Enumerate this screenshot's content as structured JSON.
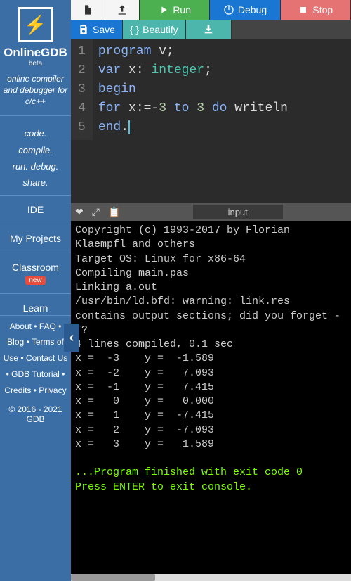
{
  "brand": {
    "logo_symbol": "⚡",
    "name": "OnlineGDB",
    "beta": "beta",
    "tagline": "online compiler and debugger for c/c++",
    "slogan_lines": [
      "code.",
      "compile.",
      "run. debug.",
      "share."
    ]
  },
  "nav": {
    "ide": "IDE",
    "projects": "My Projects",
    "classroom": "Classroom",
    "new_badge": "new",
    "learn": "Learn"
  },
  "footer": {
    "links": "About • FAQ • Blog • Terms of Use • Contact Us • GDB Tutorial • Credits • Privacy",
    "copyright": "© 2016 - 2021 GDB"
  },
  "toolbar": {
    "run": "Run",
    "debug": "Debug",
    "stop": "Stop",
    "save": "Save",
    "beautify": "Beautify"
  },
  "editor": {
    "lines": [
      "1",
      "2",
      "3",
      "4",
      "5"
    ],
    "code": {
      "l1": {
        "kw": "program",
        "v": " v;"
      },
      "l2": {
        "kw": "var",
        "v": " x: ",
        "type": "integer",
        "end": ";"
      },
      "l3": {
        "kw": "begin"
      },
      "l4": {
        "kw1": "for",
        "x": " x",
        "op": ":=-",
        "n1": "3 ",
        "kw2": "to ",
        "n2": "3 ",
        "kw3": "do ",
        "fn": "writeln"
      },
      "l5": {
        "kw": "end",
        "dot": "."
      }
    }
  },
  "terminal": {
    "input_tab": "input",
    "output": "Copyright (c) 1993-2017 by Florian Klaempfl and others\nTarget OS: Linux for x86-64\nCompiling main.pas\nLinking a.out\n/usr/bin/ld.bfd: warning: link.res contains output sections; did you forget -T?\n4 lines compiled, 0.1 sec\nx =  -3    y =  -1.589\nx =  -2    y =   7.093\nx =  -1    y =   7.415\nx =   0    y =   0.000\nx =   1    y =  -7.415\nx =   2    y =  -7.093\nx =   3    y =   1.589\n",
    "success1": "...Program finished with exit code 0",
    "success2": "Press ENTER to exit console."
  }
}
